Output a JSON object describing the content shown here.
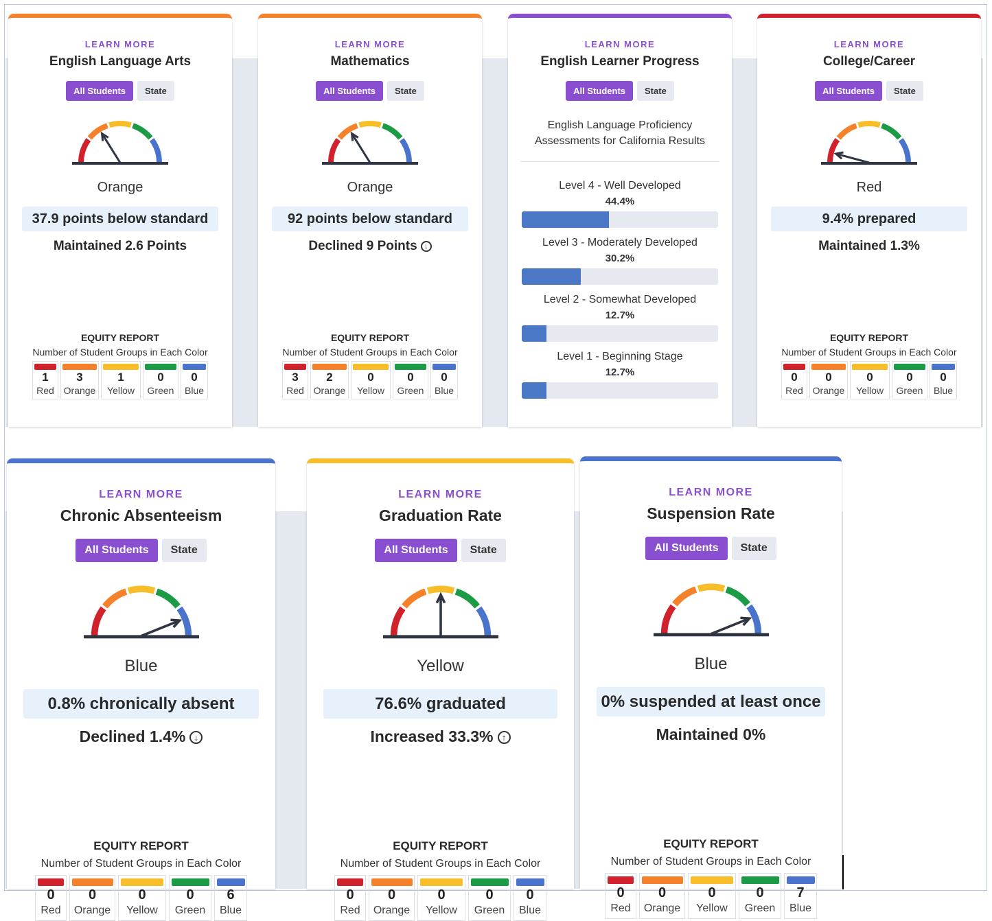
{
  "colors": {
    "red": "#d0212d",
    "orange": "#f5812a",
    "yellow": "#f8be2a",
    "green": "#1b9b45",
    "blue": "#4a74cc",
    "purple": "#8a4fd1"
  },
  "cards": [
    {
      "learn_more": "LEARN MORE",
      "title": "English Language Arts",
      "toggle": [
        "All Students",
        "State"
      ],
      "gauge_level": "orange",
      "color_label": "Orange",
      "value": "37.9 points below standard",
      "change": "Maintained 2.6 Points",
      "change_icon": "",
      "equity_title": "EQUITY REPORT",
      "equity_subtitle": "Number of Student Groups in Each Color",
      "equity": [
        {
          "count": "1",
          "name": "Red"
        },
        {
          "count": "3",
          "name": "Orange"
        },
        {
          "count": "1",
          "name": "Yellow"
        },
        {
          "count": "0",
          "name": "Green"
        },
        {
          "count": "0",
          "name": "Blue"
        }
      ]
    },
    {
      "learn_more": "LEARN MORE",
      "title": "Mathematics",
      "toggle": [
        "All Students",
        "State"
      ],
      "gauge_level": "orange",
      "color_label": "Orange",
      "value": "92 points below standard",
      "change": "Declined 9 Points",
      "change_icon": "down-circle-icon",
      "equity_title": "EQUITY REPORT",
      "equity_subtitle": "Number of Student Groups in Each Color",
      "equity": [
        {
          "count": "3",
          "name": "Red"
        },
        {
          "count": "2",
          "name": "Orange"
        },
        {
          "count": "0",
          "name": "Yellow"
        },
        {
          "count": "0",
          "name": "Green"
        },
        {
          "count": "0",
          "name": "Blue"
        }
      ]
    },
    {
      "learn_more": "LEARN MORE",
      "title": "English Learner Progress",
      "toggle": [
        "All Students",
        "State"
      ],
      "description": "English Language Proficiency Assessments for California Results",
      "levels": [
        {
          "label": "Level 4 - Well Developed",
          "pct": "44.4%",
          "value": 44.4
        },
        {
          "label": "Level 3 - Moderately Developed",
          "pct": "30.2%",
          "value": 30.2
        },
        {
          "label": "Level 2 - Somewhat Developed",
          "pct": "12.7%",
          "value": 12.7
        },
        {
          "label": "Level 1 - Beginning Stage",
          "pct": "12.7%",
          "value": 12.7
        }
      ]
    },
    {
      "learn_more": "LEARN MORE",
      "title": "College/Career",
      "toggle": [
        "All Students",
        "State"
      ],
      "gauge_level": "red",
      "color_label": "Red",
      "value": "9.4% prepared",
      "change": "Maintained 1.3%",
      "change_icon": "",
      "equity_title": "EQUITY REPORT",
      "equity_subtitle": "Number of Student Groups in Each Color",
      "equity": [
        {
          "count": "0",
          "name": "Red"
        },
        {
          "count": "0",
          "name": "Orange"
        },
        {
          "count": "0",
          "name": "Yellow"
        },
        {
          "count": "0",
          "name": "Green"
        },
        {
          "count": "0",
          "name": "Blue"
        }
      ]
    },
    {
      "learn_more": "LEARN MORE",
      "title": "Chronic Absenteeism",
      "toggle": [
        "All Students",
        "State"
      ],
      "gauge_level": "blue",
      "color_label": "Blue",
      "value": "0.8% chronically absent",
      "change": "Declined 1.4%",
      "change_icon": "down-circle-icon",
      "equity_title": "EQUITY REPORT",
      "equity_subtitle": "Number of Student Groups in Each Color",
      "equity": [
        {
          "count": "0",
          "name": "Red"
        },
        {
          "count": "0",
          "name": "Orange"
        },
        {
          "count": "0",
          "name": "Yellow"
        },
        {
          "count": "0",
          "name": "Green"
        },
        {
          "count": "6",
          "name": "Blue"
        }
      ]
    },
    {
      "learn_more": "LEARN MORE",
      "title": "Graduation Rate",
      "toggle": [
        "All Students",
        "State"
      ],
      "gauge_level": "yellow",
      "color_label": "Yellow",
      "value": "76.6% graduated",
      "change": "Increased 33.3%",
      "change_icon": "up-circle-icon",
      "equity_title": "EQUITY REPORT",
      "equity_subtitle": "Number of Student Groups in Each Color",
      "equity": [
        {
          "count": "0",
          "name": "Red"
        },
        {
          "count": "0",
          "name": "Orange"
        },
        {
          "count": "0",
          "name": "Yellow"
        },
        {
          "count": "0",
          "name": "Green"
        },
        {
          "count": "0",
          "name": "Blue"
        }
      ]
    },
    {
      "learn_more": "LEARN MORE",
      "title": "Suspension Rate",
      "toggle": [
        "All Students",
        "State"
      ],
      "gauge_level": "blue",
      "color_label": "Blue",
      "value": "0% suspended at least once",
      "change": "Maintained 0%",
      "change_icon": "",
      "equity_title": "EQUITY REPORT",
      "equity_subtitle": "Number of Student Groups in Each Color",
      "equity": [
        {
          "count": "0",
          "name": "Red"
        },
        {
          "count": "0",
          "name": "Orange"
        },
        {
          "count": "0",
          "name": "Yellow"
        },
        {
          "count": "0",
          "name": "Green"
        },
        {
          "count": "7",
          "name": "Blue"
        }
      ]
    }
  ]
}
